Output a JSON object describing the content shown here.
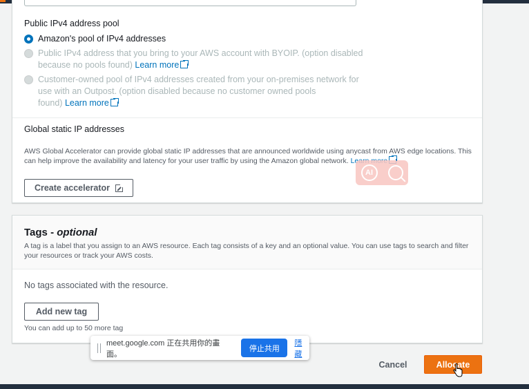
{
  "ipv4_pool": {
    "heading": "Public IPv4 address pool",
    "options": [
      {
        "label": "Amazon's pool of IPv4 addresses",
        "checked": true,
        "disabled": false
      },
      {
        "line1": "Public IPv4 address that you bring to your AWS account with BYOIP. (option disabled",
        "line2": "because no pools found)",
        "link": "Learn more",
        "checked": false,
        "disabled": true
      },
      {
        "line1": "Customer-owned pool of IPv4 addresses created from your on-premises network for",
        "line2": "use with an Outpost. (option disabled because no customer owned pools",
        "line3": "found)",
        "link": "Learn more",
        "checked": false,
        "disabled": true
      }
    ]
  },
  "global_ip": {
    "heading": "Global static IP addresses",
    "desc1": "AWS Global Accelerator can provide global static IP addresses that are announced worldwide using anycast from AWS edge locations. This",
    "desc2": "can help improve the availability and latency for your user traffic by using the Amazon global network.",
    "link": "Learn more",
    "button": "Create accelerator"
  },
  "overlay_badge": {
    "ai_label": "AI",
    "ai_icon": "ai-circle-icon",
    "search_icon": "search-icon"
  },
  "tags": {
    "title": "Tags - ",
    "title_italic": "optional",
    "desc1": "A tag is a label that you assign to an AWS resource. Each tag consists of a key and an optional value. You can use tags to search and filter",
    "desc2": "your resources or track your AWS costs.",
    "empty": "No tags associated with the resource.",
    "add_button": "Add new tag",
    "limit": "You can add up to 50 more tag"
  },
  "screen_share": {
    "message": "meet.google.com 正在共用你的畫面。",
    "stop_button": "停止共用",
    "hide_link": "隱藏"
  },
  "footer": {
    "cancel": "Cancel",
    "allocate": "Allocate"
  },
  "colors": {
    "accent": "#0073bb",
    "primary_button": "#ec7211",
    "share_button": "#1a73e8",
    "header": "#232f3e"
  }
}
